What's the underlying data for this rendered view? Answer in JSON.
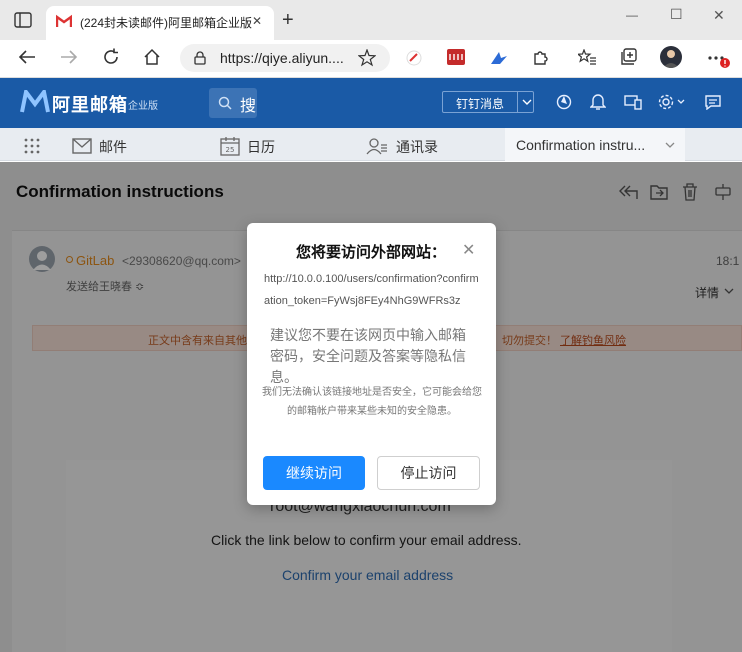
{
  "browser": {
    "tab_title": "(224封未读邮件)阿里邮箱企业版",
    "url": "https://qiye.aliyun....",
    "new_tab": "+",
    "win_minimize": "—",
    "win_maximize": "☐",
    "win_close": "✕"
  },
  "app": {
    "logo": "阿里邮箱",
    "logo_sub": "企业版",
    "search_placeholder": "搜",
    "dingding": "钉钉消息"
  },
  "nav": {
    "mail": "邮件",
    "calendar": "日历",
    "calendar_day": "25",
    "contacts": "通讯录",
    "active_tab": "Confirmation instru..."
  },
  "mail": {
    "subject": "Confirmation instructions",
    "sender_name": "GitLab",
    "sender_email": "<29308620@qq.com>",
    "sent_to": "发送给王晓春 ≎",
    "time": "18:1",
    "details": "详情",
    "warn_left": "正文中含有来自其他",
    "warn_right": "切勿提交！",
    "warn_link": "了解钓鱼风险",
    "body_root": "root@wangxiaochun.com",
    "body_text": "Click the link below to confirm your email address.",
    "body_link": "Confirm your email address"
  },
  "modal": {
    "title": "您将要访问外部网站：",
    "close": "✕",
    "url": "http://10.0.0.100/users/confirmation?confirmation_token=FyWsj8FEy4NhG9WFRs3z",
    "advice": "建议您不要在该网页中输入邮箱密码，安全问题及答案等隐私信息。",
    "note": "我们无法确认该链接地址是否安全，它可能会给您的邮箱帐户带来某些未知的安全隐患。",
    "continue": "继续访问",
    "stop": "停止访问"
  },
  "colors": {
    "brand": "#1a5aa6",
    "primary_button": "#1a89ff",
    "sender": "#e38a1c"
  }
}
